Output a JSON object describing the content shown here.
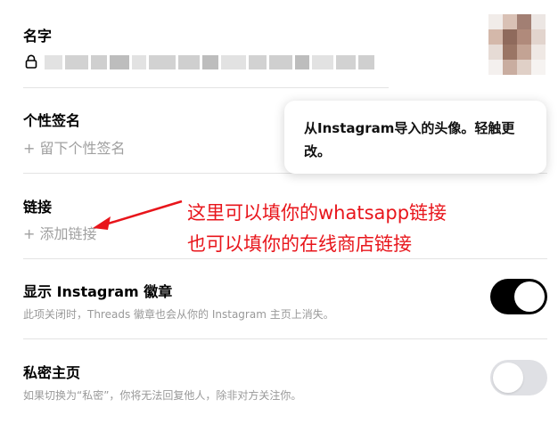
{
  "name_section": {
    "label": "名字"
  },
  "bio_section": {
    "label": "个性签名",
    "placeholder": "+ 留下个性签名"
  },
  "link_section": {
    "label": "链接",
    "placeholder": "+ 添加链接"
  },
  "avatar_tooltip": {
    "text": "从Instagram导入的头像。轻触更改。"
  },
  "annotation": {
    "line1": "这里可以填你的whatsapp链接",
    "line2": "也可以填你的在线商店链接",
    "color": "#e8151b"
  },
  "instagram_badge": {
    "label": "显示 Instagram 徽章",
    "description": "此项关闭时，Threads 徽章也会从你的 Instagram 主页上消失。",
    "enabled": true
  },
  "private_profile": {
    "label": "私密主页",
    "description": "如果切换为“私密”，你将无法回复他人，除非对方关注你。",
    "enabled": false
  },
  "icons": {
    "lock": "lock-icon",
    "avatar": "avatar"
  }
}
